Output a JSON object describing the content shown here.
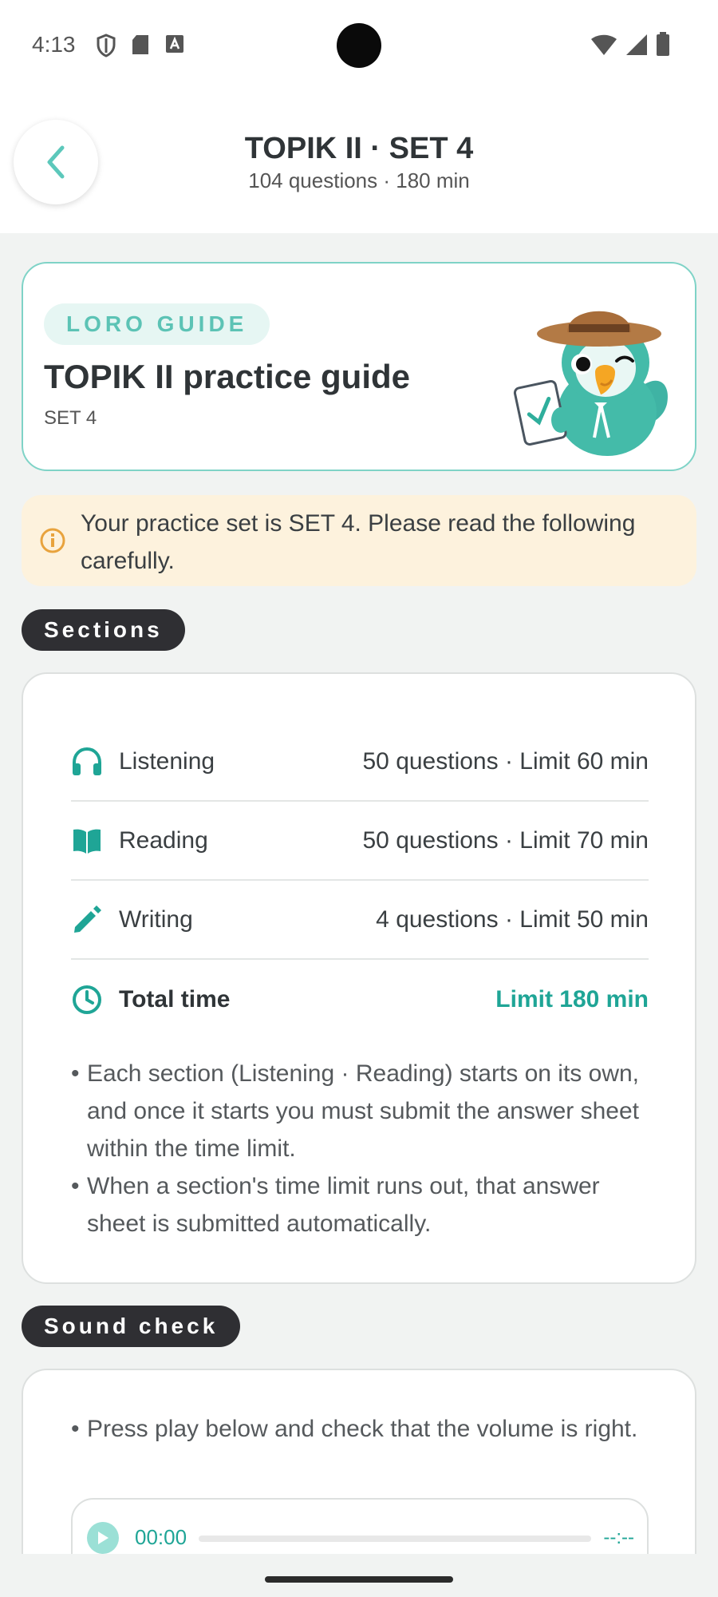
{
  "status_bar": {
    "time": "4:13",
    "left_icons": [
      "shield-icon",
      "sd-card-icon",
      "font-icon"
    ],
    "right_icons": [
      "wifi-icon",
      "signal-icon",
      "battery-icon"
    ]
  },
  "header": {
    "title": "TOPIK II · SET 4",
    "subtitle": "104 questions · 180 min",
    "back_icon": "chevron-left-icon"
  },
  "guide_card": {
    "badge": "LORO GUIDE",
    "title": "TOPIK II practice guide",
    "set_label": "SET 4",
    "mascot": "parrot-mascot-illustration"
  },
  "notice": {
    "icon": "info-icon",
    "text": "Your practice set is SET 4. Please read the following carefully."
  },
  "sections": {
    "heading": "Sections",
    "rows": [
      {
        "icon": "headphones-icon",
        "label": "Listening",
        "value": "50 questions · Limit 60 min"
      },
      {
        "icon": "book-icon",
        "label": "Reading",
        "value": "50 questions · Limit 70 min"
      },
      {
        "icon": "pencil-icon",
        "label": "Writing",
        "value": "4 questions · Limit 50 min"
      },
      {
        "icon": "clock-icon",
        "label": "Total time",
        "value": "Limit 180 min"
      }
    ],
    "notes": [
      "Each section (Listening · Reading) starts on its own, and once it starts you must submit the answer sheet within the time limit.",
      "When a section's time limit runs out, that answer sheet is submitted automatically."
    ]
  },
  "sound_check": {
    "heading": "Sound check",
    "note": "Press play below and check that the volume is right.",
    "player": {
      "current_time": "00:00",
      "duration": "--:--",
      "progress": 0
    }
  },
  "colors": {
    "accent": "#1fa596",
    "guide_border": "#7fd3c7",
    "notice_bg": "#fdf2dd",
    "notice_icon": "#e8a33d",
    "pill_bg": "#2f2f33",
    "page_bg": "#f1f3f2"
  }
}
